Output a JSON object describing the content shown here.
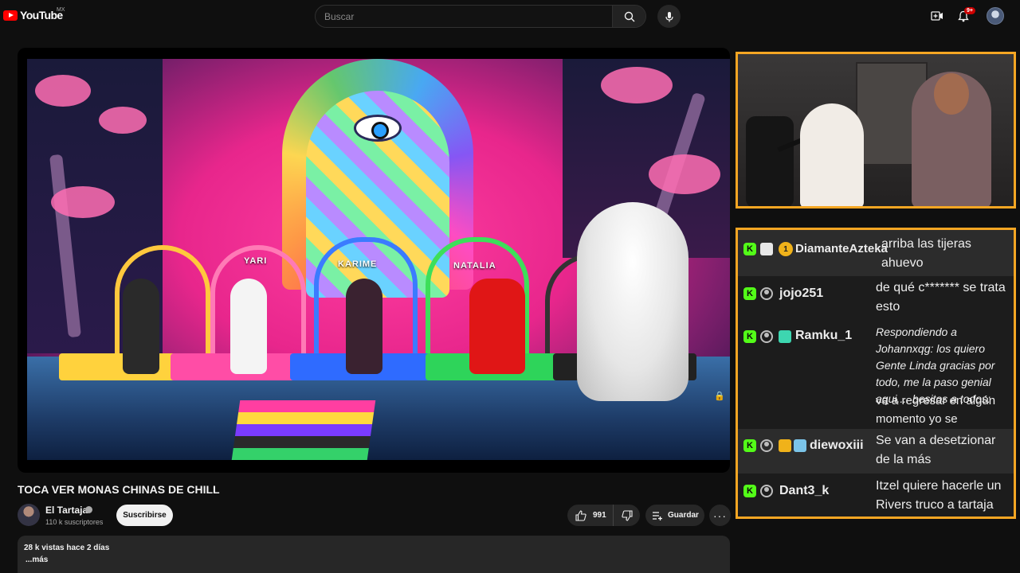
{
  "header": {
    "logo_text": "YouTube",
    "region": "MX",
    "search_placeholder": "Buscar",
    "notifications_count": "9+"
  },
  "video": {
    "title": "TOCA VER MONAS CHINAS DE CHILL",
    "stage_names": [
      "YARI",
      "KARIME",
      "NATALIA"
    ]
  },
  "channel": {
    "name": "El Tartaja",
    "subscribers": "110 k suscriptores",
    "subscribe_label": "Suscribirse"
  },
  "actions": {
    "like_count": "991",
    "save_label": "Guardar"
  },
  "description": {
    "meta": "28 k vistas  hace 2 días",
    "more": "...más"
  },
  "chat": {
    "messages": [
      {
        "user": "DiamanteAzteka",
        "text": "arriba las tijeras ahuevo",
        "italic": false,
        "extra_badge": "1"
      },
      {
        "user": "jojo251",
        "text": "de qué c******* se trata esto",
        "italic": false
      },
      {
        "user": "Ramku_1",
        "text": "Respondiendo a Johannxqg: los quiero Gente Linda gracias por todo, me la paso genial aqui.... besitos a todos:",
        "tail": "va a regresar en algún momento yo se",
        "italic": true
      },
      {
        "user": "diewoxiii",
        "text": "Se van a desetzionar de la más",
        "italic": false
      },
      {
        "user": "Dant3_k",
        "text": "Itzel quiere hacerle un Rivers truco a tartaja",
        "italic": false
      }
    ]
  },
  "colors": {
    "accent_orange": "#f5a623",
    "kick_green": "#53fc18",
    "youtube_red": "#ff0000"
  }
}
